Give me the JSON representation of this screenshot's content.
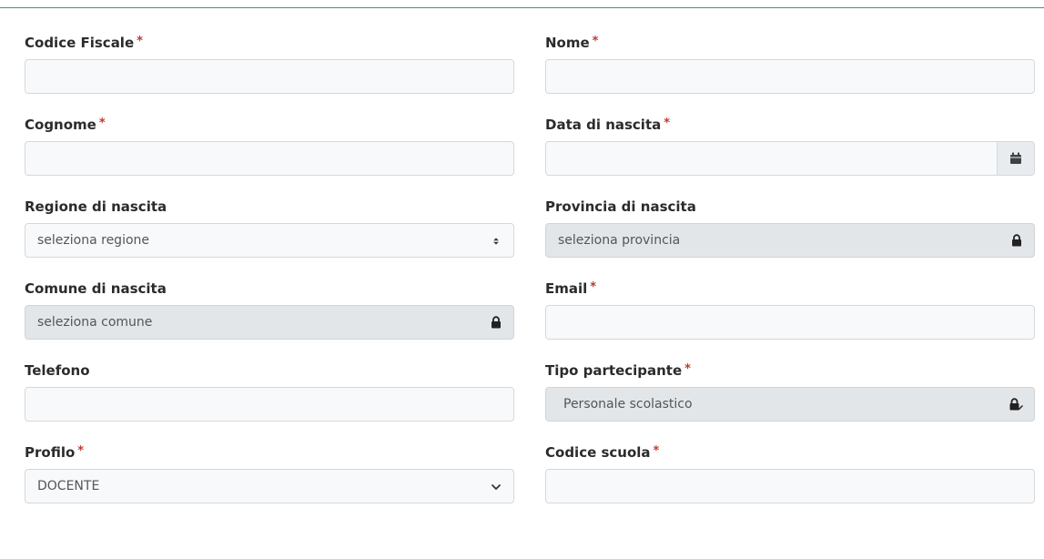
{
  "required_marker": "*",
  "colors": {
    "accent": "#3a9a73",
    "required": "#c0392b"
  },
  "fields": {
    "codice_fiscale": {
      "label": "Codice Fiscale",
      "value": ""
    },
    "nome": {
      "label": "Nome",
      "value": ""
    },
    "cognome": {
      "label": "Cognome",
      "value": ""
    },
    "data_nascita": {
      "label": "Data di nascita",
      "value": "",
      "icon": "calendar-icon"
    },
    "regione_nascita": {
      "label": "Regione di nascita",
      "selected": "seleziona regione",
      "icon": "sort-arrows-icon"
    },
    "provincia_nascita": {
      "label": "Provincia di nascita",
      "selected": "seleziona provincia",
      "icon": "lock-icon"
    },
    "comune_nascita": {
      "label": "Comune di nascita",
      "selected": "seleziona comune",
      "icon": "lock-icon"
    },
    "email": {
      "label": "Email",
      "value": ""
    },
    "telefono": {
      "label": "Telefono",
      "value": ""
    },
    "tipo_partecipante": {
      "label": "Tipo partecipante",
      "selected": "Personale scolastico",
      "icon": "lock-edit-icon"
    },
    "profilo": {
      "label": "Profilo",
      "selected": "DOCENTE",
      "icon": "chevron-down-icon"
    },
    "codice_scuola": {
      "label": "Codice scuola",
      "value": ""
    }
  }
}
